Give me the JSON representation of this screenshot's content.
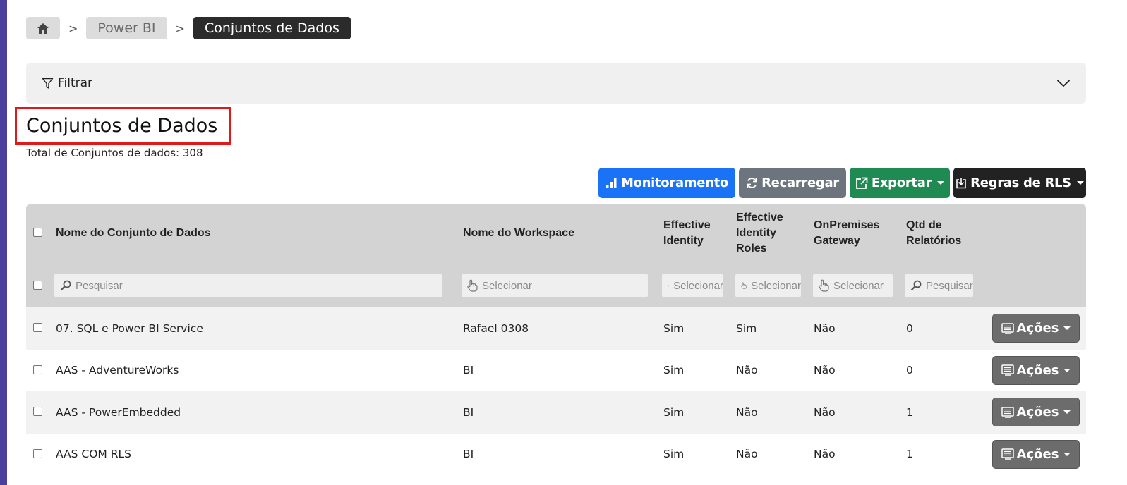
{
  "breadcrumb": {
    "home_icon": "home-icon",
    "item1": "Power BI",
    "item2": "Conjuntos de Dados"
  },
  "filter": {
    "label": "Filtrar",
    "icon": "filter-icon",
    "chevron": "chevron-down-icon"
  },
  "page": {
    "title": "Conjuntos de Dados",
    "total": "Total de Conjuntos de dados: 308",
    "highlight_color": "#e0191b"
  },
  "toolbar": {
    "monitoramento": "Monitoramento",
    "recarregar": "Recarregar",
    "exportar": "Exportar",
    "regras_rls": "Regras de RLS",
    "colors": {
      "blue": "#1a73f6",
      "gray": "#6c757d",
      "green": "#1f8a52",
      "dark": "#222222"
    }
  },
  "table": {
    "headers": {
      "nome": "Nome do Conjunto de Dados",
      "workspace": "Nome do Workspace",
      "ei": "Effective Identity",
      "eir": "Effective Identity Roles",
      "onprem": "OnPremises Gateway",
      "qtd": "Qtd de Relatórios"
    },
    "filters": {
      "nome": "Pesquisar",
      "workspace": "Selecionar",
      "ei": "Selecionar",
      "eir": "Selecionar",
      "onprem": "Selecionar",
      "qtd": "Pesquisar"
    },
    "action_label": "Ações",
    "rows": [
      {
        "nome": "07. SQL e Power BI Service",
        "workspace": "Rafael 0308",
        "ei": "Sim",
        "eir": "Sim",
        "onprem": "Não",
        "qtd": "0"
      },
      {
        "nome": "AAS - AdventureWorks",
        "workspace": "BI",
        "ei": "Sim",
        "eir": "Não",
        "onprem": "Não",
        "qtd": "0"
      },
      {
        "nome": "AAS - PowerEmbedded",
        "workspace": "BI",
        "ei": "Sim",
        "eir": "Não",
        "onprem": "Não",
        "qtd": "1"
      },
      {
        "nome": "AAS COM RLS",
        "workspace": "BI",
        "ei": "Sim",
        "eir": "Não",
        "onprem": "Não",
        "qtd": "1"
      }
    ]
  }
}
